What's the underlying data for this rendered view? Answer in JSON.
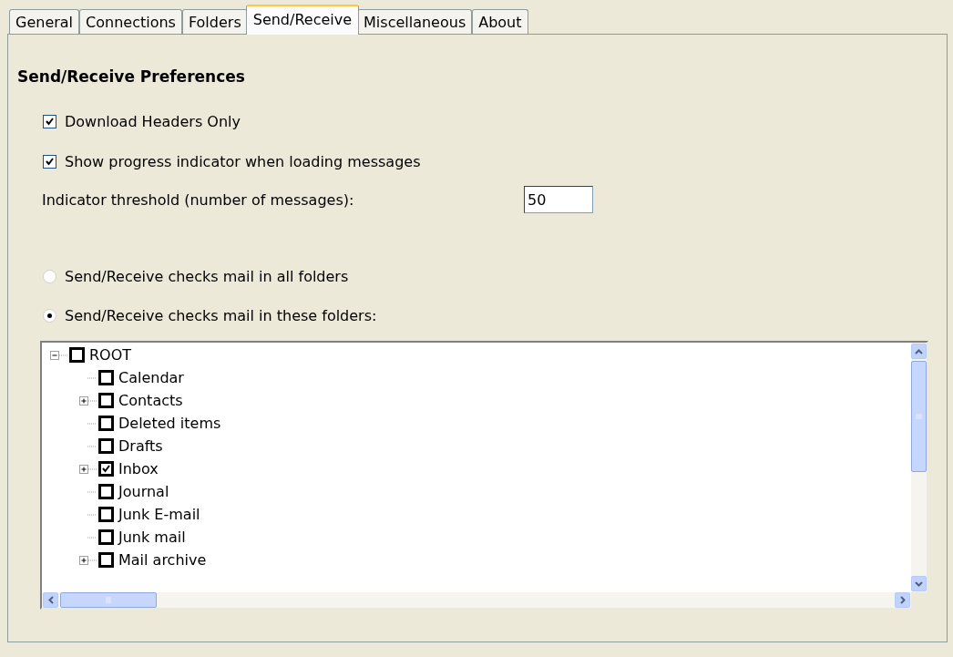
{
  "tabs": [
    {
      "label": "General",
      "selected": false
    },
    {
      "label": "Connections",
      "selected": false
    },
    {
      "label": "Folders",
      "selected": false
    },
    {
      "label": "Send/Receive",
      "selected": true
    },
    {
      "label": "Miscellaneous",
      "selected": false
    },
    {
      "label": "About",
      "selected": false
    }
  ],
  "heading": "Send/Receive Preferences",
  "options": [
    {
      "label": "Download Headers Only",
      "checked": true
    },
    {
      "label": "Show progress indicator when loading messages",
      "checked": true
    }
  ],
  "threshold": {
    "label": "Indicator threshold (number of messages):",
    "value": "50"
  },
  "modes": [
    {
      "label": "Send/Receive checks mail in all folders",
      "selected": false
    },
    {
      "label": "Send/Receive checks mail in these folders:",
      "selected": true
    }
  ],
  "folder_tree": {
    "label": "ROOT",
    "checked": false,
    "expanded": true,
    "children": [
      {
        "label": "Calendar",
        "checked": false,
        "expandable": false
      },
      {
        "label": "Contacts",
        "checked": false,
        "expandable": true
      },
      {
        "label": "Deleted items",
        "checked": false,
        "expandable": false
      },
      {
        "label": "Drafts",
        "checked": false,
        "expandable": false
      },
      {
        "label": "Inbox",
        "checked": true,
        "expandable": true
      },
      {
        "label": "Journal",
        "checked": false,
        "expandable": false
      },
      {
        "label": "Junk E-mail",
        "checked": false,
        "expandable": false
      },
      {
        "label": "Junk mail",
        "checked": false,
        "expandable": false
      },
      {
        "label": "Mail archive",
        "checked": false,
        "expandable": true
      }
    ]
  }
}
